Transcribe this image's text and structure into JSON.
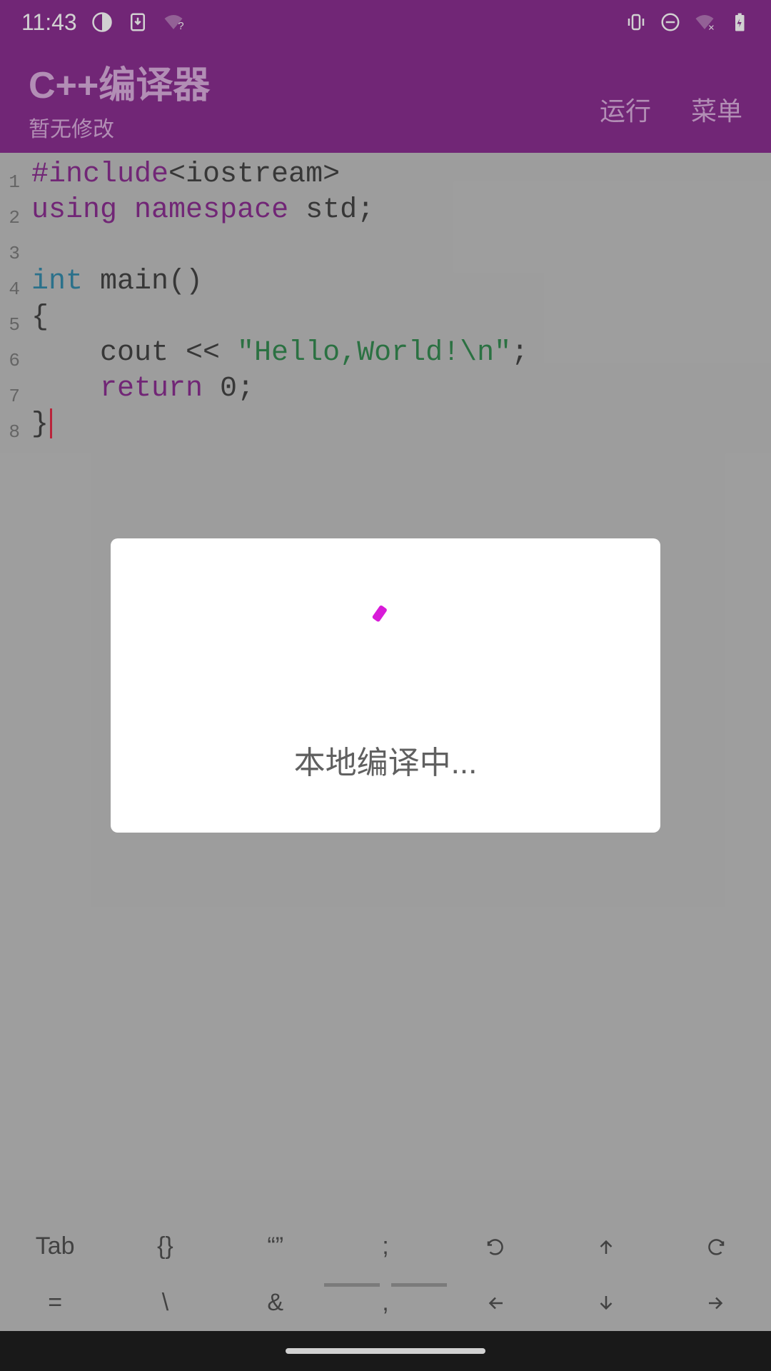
{
  "status_bar": {
    "time": "11:43"
  },
  "app_bar": {
    "title": "C++编译器",
    "subtitle": "暂无修改",
    "actions": {
      "run": "运行",
      "menu": "菜单"
    }
  },
  "editor": {
    "lines": [
      {
        "n": "1",
        "tokens": [
          {
            "t": "#include",
            "c": "preproc"
          },
          {
            "t": "<iostream>",
            "c": "angle"
          }
        ]
      },
      {
        "n": "2",
        "tokens": [
          {
            "t": "using",
            "c": "keyword"
          },
          {
            "t": " ",
            "c": "punct"
          },
          {
            "t": "namespace",
            "c": "keyword"
          },
          {
            "t": " std;",
            "c": "punct"
          }
        ]
      },
      {
        "n": "3",
        "tokens": []
      },
      {
        "n": "4",
        "tokens": [
          {
            "t": "int",
            "c": "type"
          },
          {
            "t": " main()",
            "c": "ident"
          }
        ]
      },
      {
        "n": "5",
        "tokens": [
          {
            "t": "{",
            "c": "punct"
          }
        ]
      },
      {
        "n": "6",
        "tokens": [
          {
            "t": "    cout << ",
            "c": "ident"
          },
          {
            "t": "\"Hello,World!\\n\"",
            "c": "string"
          },
          {
            "t": ";",
            "c": "punct"
          }
        ]
      },
      {
        "n": "7",
        "tokens": [
          {
            "t": "    ",
            "c": "punct"
          },
          {
            "t": "return",
            "c": "keyword"
          },
          {
            "t": " 0;",
            "c": "punct"
          }
        ]
      },
      {
        "n": "8",
        "tokens": [
          {
            "t": "}",
            "c": "punct"
          }
        ],
        "cursor_after": true
      }
    ]
  },
  "keyboard": {
    "row1": [
      "Tab",
      "{}",
      "“”",
      ";",
      "undo",
      "up",
      "redo"
    ],
    "row2": [
      "=",
      "\\",
      "&",
      ",",
      "left",
      "down",
      "right"
    ]
  },
  "dialog": {
    "message": "本地编译中..."
  }
}
